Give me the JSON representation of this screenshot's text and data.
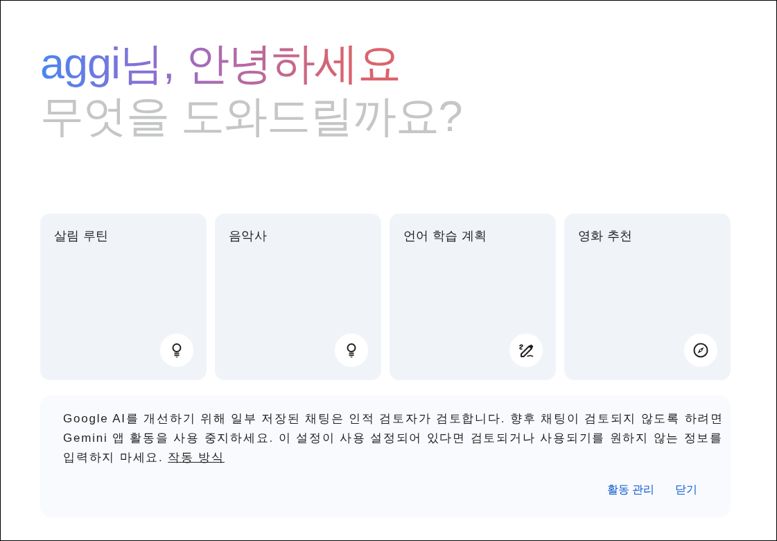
{
  "greeting": {
    "title": "aggi님, 안녕하세요",
    "subtitle": "무엇을 도와드릴까요?"
  },
  "suggestions": [
    {
      "label": "살림 루틴",
      "kind": "idea"
    },
    {
      "label": "음악사",
      "kind": "idea"
    },
    {
      "label": "언어 학습 계획",
      "kind": "write"
    },
    {
      "label": "영화 추천",
      "kind": "explore"
    }
  ],
  "notice": {
    "text": "Google AI를 개선하기 위해 일부 저장된 채팅은 인적 검토자가 검토합니다. 향후 채팅이 검토되지 않도록 하려면 Gemini 앱 활동을 사용 중지하세요. 이 설정이 사용 설정되어 있다면 검토되거나 사용되기를 원하지 않는 정보를 입력하지 마세요.",
    "link": "작동 방식",
    "actions": [
      "활동 관리",
      "닫기"
    ]
  }
}
